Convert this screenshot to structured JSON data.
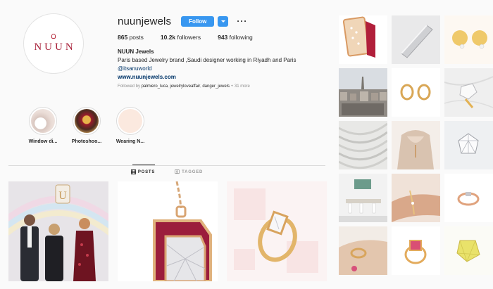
{
  "profile": {
    "avatar_wordmark": "NUUN",
    "username": "nuunjewels",
    "follow_label": "Follow",
    "more_label": "···",
    "posts_count": "865",
    "posts_label": "posts",
    "followers_count": "10.2k",
    "followers_label": "followers",
    "following_count": "943",
    "following_label": "following",
    "full_name": "NUUN Jewels",
    "bio_line": "Paris based Jewelry brand ,Saudi designer working in Riyadh and Paris",
    "bio_tag": "@itsanuworld",
    "website": "www.nuunjewels.com",
    "followed_by_prefix": "Followed by",
    "followed_by_1": "palmiero_luca",
    "followed_by_2": "jewelryloveaffair",
    "followed_by_3": "danger_jewels",
    "followed_by_more": "+ 31 more"
  },
  "highlights": [
    {
      "label": "Window di..."
    },
    {
      "label": "Photoshoo..."
    },
    {
      "label": "Wearing N..."
    }
  ],
  "tabs": [
    {
      "label": "POSTS",
      "icon": "grid-icon",
      "active": true
    },
    {
      "label": "TAGGED",
      "icon": "tag-icon",
      "active": false
    }
  ],
  "colors": {
    "accent": "#3897f0",
    "brand": "#a8213a",
    "link": "#003569",
    "muted": "#8e8e8e"
  },
  "posts": [
    {
      "subject": "team photo in store"
    },
    {
      "subject": "ruby pendant closeup"
    },
    {
      "subject": "baguette diamond ring"
    }
  ],
  "grid": [
    {
      "subject": "diamond bar ring"
    },
    {
      "subject": "silver bar pendant"
    },
    {
      "subject": "gold dot earrings"
    },
    {
      "subject": "paris rooftops"
    },
    {
      "subject": "gold hoop earrings"
    },
    {
      "subject": "diamond ring on marble"
    },
    {
      "subject": "architecture lines"
    },
    {
      "subject": "model wearing necklace"
    },
    {
      "subject": "geometric diamond pendant"
    },
    {
      "subject": "boutique interior"
    },
    {
      "subject": "bracelet on wrist"
    },
    {
      "subject": "rose gold ring"
    },
    {
      "subject": "ring on hand"
    },
    {
      "subject": "ruby ring closeup"
    },
    {
      "subject": "yellow stone ring"
    }
  ]
}
